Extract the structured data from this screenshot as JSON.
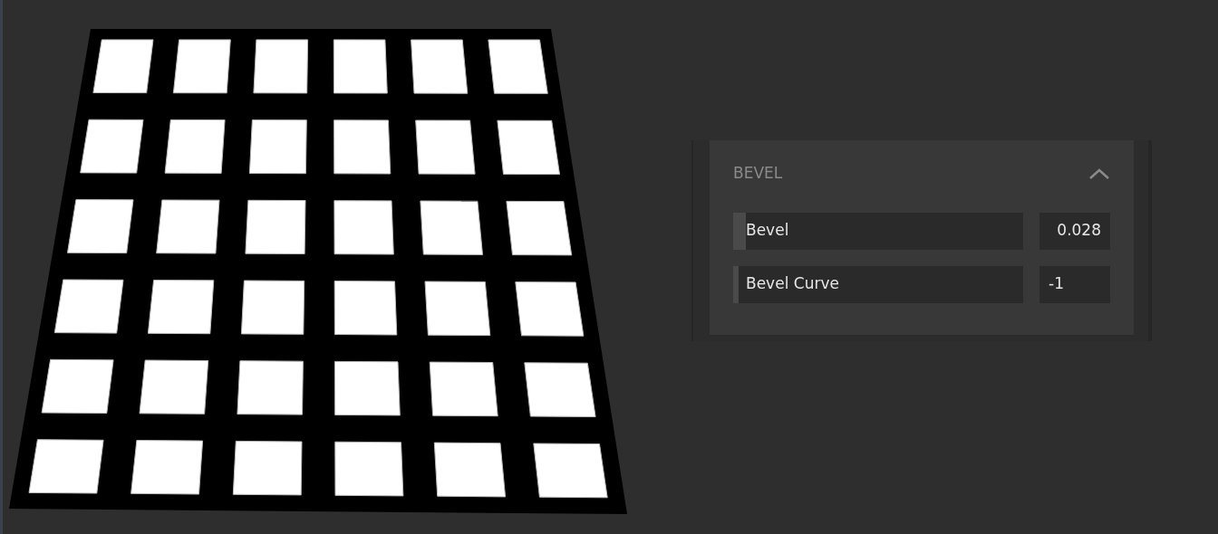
{
  "panel": {
    "title": "BEVEL",
    "expanded": true,
    "sliders": [
      {
        "label": "Bevel",
        "level": 0.045,
        "value": "0.028"
      },
      {
        "label": "Bevel Curve",
        "level": 0.02,
        "value": "-1"
      }
    ]
  }
}
